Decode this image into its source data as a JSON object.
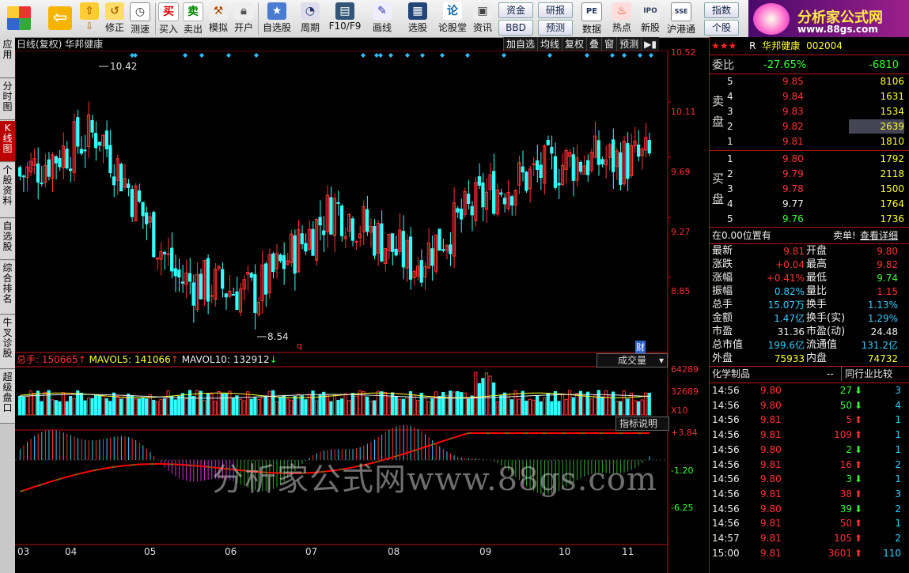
{
  "toolbar": {
    "buttons": [
      "修正",
      "测速",
      "买入",
      "卖出",
      "模拟",
      "开户",
      "自选股",
      "周期",
      "F10/F9",
      "画线",
      "选股",
      "论股堂",
      "资讯",
      "数据",
      "热点",
      "新股",
      "沪港通"
    ],
    "small_buttons": [
      "资金",
      "研报",
      "指数",
      "BBD",
      "预测",
      "个股"
    ]
  },
  "logo": {
    "title": "分析家公式网",
    "url": "www.88gs.com"
  },
  "left_tabs": [
    "应用",
    "分时图",
    "K线图",
    "个股资料",
    "自选股",
    "综合排名",
    "牛叉诊股",
    "超级盘口"
  ],
  "chart": {
    "title": "日线(复权)  华邦健康",
    "tools": [
      "加自选",
      "均线",
      "复权",
      "叠",
      "窗",
      "预测"
    ],
    "price_labels": [
      "10.52",
      "10.11",
      "9.69",
      "9.27",
      "8.85"
    ],
    "high_label": "10.42",
    "low_label": "8.54",
    "marker_q": "q",
    "marker_cai": "财",
    "volume": {
      "label": "总手",
      "value": "150665",
      "ma5_label": "MAVOL5:",
      "ma5": "141066",
      "ma10_label": "MAVOL10:",
      "ma10": "132912",
      "labels": [
        "64289",
        "32689",
        "X10"
      ],
      "dropdown": "成交量"
    },
    "indicator": {
      "dropdown": "指标说明",
      "labels": [
        "+3.84",
        "-1.20",
        "-6.25"
      ]
    },
    "months": [
      "03",
      "04",
      "05",
      "06",
      "07",
      "08",
      "09",
      "10",
      "11"
    ]
  },
  "chart_data": {
    "type": "candlestick",
    "x": [
      "03",
      "04",
      "05",
      "06",
      "07",
      "08",
      "09",
      "10",
      "11"
    ],
    "price_range": [
      8.54,
      10.52
    ],
    "approx_close_by_month": [
      9.7,
      10.0,
      9.0,
      8.9,
      9.5,
      9.1,
      9.6,
      9.8,
      9.81
    ],
    "volume_range": [
      0,
      64289
    ]
  },
  "quote": {
    "name": "华邦健康",
    "code": "002004",
    "stars": "★★★",
    "weibi_label": "委比",
    "weibi": "-27.65%",
    "weicha": "-6810",
    "sell_label": [
      "卖",
      "盘"
    ],
    "buy_label": [
      "买",
      "盘"
    ],
    "sells": [
      {
        "lvl": "5",
        "price": "9.85",
        "vol": "8106"
      },
      {
        "lvl": "4",
        "price": "9.84",
        "vol": "1631"
      },
      {
        "lvl": "3",
        "price": "9.83",
        "vol": "1534"
      },
      {
        "lvl": "2",
        "price": "9.82",
        "vol": "2639"
      },
      {
        "lvl": "1",
        "price": "9.81",
        "vol": "1810"
      }
    ],
    "buys": [
      {
        "lvl": "1",
        "price": "9.80",
        "vol": "1792"
      },
      {
        "lvl": "2",
        "price": "9.79",
        "vol": "2118"
      },
      {
        "lvl": "3",
        "price": "9.78",
        "vol": "1500"
      },
      {
        "lvl": "4",
        "price": "9.77",
        "vol": "1764"
      },
      {
        "lvl": "5",
        "price": "9.76",
        "vol": "1736"
      }
    ],
    "pos_text": "在0.00位置有",
    "sell_single": "卖单!",
    "detail": "查看详细",
    "stats": [
      {
        "k1": "最新",
        "v1": "9.81",
        "k2": "开盘",
        "v2": "9.80"
      },
      {
        "k1": "涨跌",
        "v1": "+0.04",
        "k2": "最高",
        "v2": "9.82"
      },
      {
        "k1": "涨幅",
        "v1": "+0.41%",
        "k2": "最低",
        "v2": "9.74"
      },
      {
        "k1": "振幅",
        "v1": "0.82%",
        "k2": "量比",
        "v2": "1.15"
      },
      {
        "k1": "总手",
        "v1": "15.07万",
        "k2": "换手",
        "v2": "1.13%"
      },
      {
        "k1": "金额",
        "v1": "1.47亿",
        "k2": "换手(实)",
        "v2": "1.29%"
      },
      {
        "k1": "市盈",
        "v1": "31.36",
        "k2": "市盈(动)",
        "v2": "24.48"
      },
      {
        "k1": "总市值",
        "v1": "199.6亿",
        "k2": "流通值",
        "v2": "131.2亿"
      },
      {
        "k1": "外盘",
        "v1": "75933",
        "k2": "内盘",
        "v2": "74732"
      }
    ],
    "industry": "化学制品",
    "industry_btn": "同行业比较",
    "ticks": [
      {
        "t": "14:56",
        "p": "9.80",
        "v": "27",
        "n": "3",
        "dir": "down"
      },
      {
        "t": "14:56",
        "p": "9.80",
        "v": "50",
        "n": "4",
        "dir": "down"
      },
      {
        "t": "14:56",
        "p": "9.81",
        "v": "5",
        "n": "1",
        "dir": "up"
      },
      {
        "t": "14:56",
        "p": "9.81",
        "v": "109",
        "n": "1",
        "dir": "up"
      },
      {
        "t": "14:56",
        "p": "9.80",
        "v": "2",
        "n": "1",
        "dir": "down"
      },
      {
        "t": "14:56",
        "p": "9.81",
        "v": "16",
        "n": "2",
        "dir": "up"
      },
      {
        "t": "14:56",
        "p": "9.80",
        "v": "3",
        "n": "1",
        "dir": "down"
      },
      {
        "t": "14:56",
        "p": "9.81",
        "v": "38",
        "n": "3",
        "dir": "up"
      },
      {
        "t": "14:56",
        "p": "9.80",
        "v": "39",
        "n": "2",
        "dir": "down"
      },
      {
        "t": "14:56",
        "p": "9.81",
        "v": "50",
        "n": "1",
        "dir": "up"
      },
      {
        "t": "14:57",
        "p": "9.81",
        "v": "105",
        "n": "2",
        "dir": "up"
      },
      {
        "t": "15:00",
        "p": "9.81",
        "v": "3601",
        "n": "110",
        "dir": "up"
      }
    ]
  },
  "watermark": "分析家公式网www.88gs.com"
}
